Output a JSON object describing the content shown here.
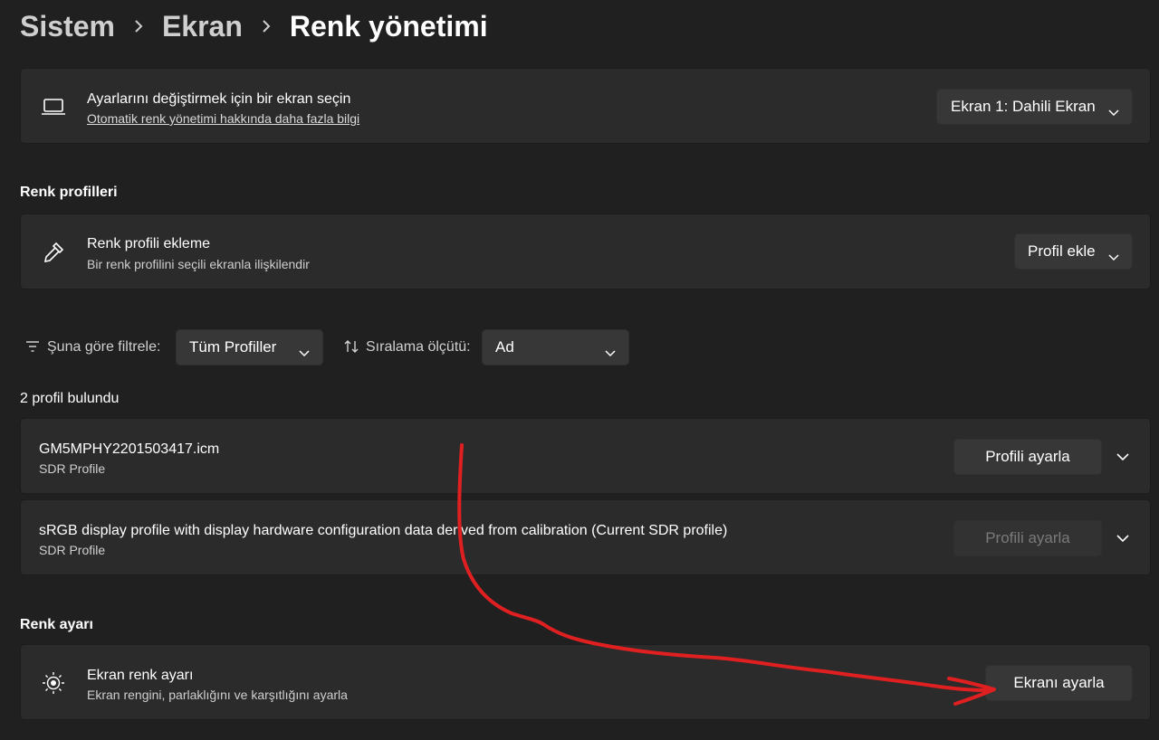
{
  "breadcrumb": {
    "items": [
      "Sistem",
      "Ekran",
      "Renk yönetimi"
    ]
  },
  "display_select": {
    "title": "Ayarlarını değiştirmek için bir ekran seçin",
    "link": "Otomatik renk yönetimi hakkında daha fazla bilgi",
    "dropdown_value": "Ekran 1: Dahili Ekran"
  },
  "color_profiles": {
    "section_title": "Renk profilleri",
    "add_title": "Renk profili ekleme",
    "add_subtitle": "Bir renk profilini seçili ekranla ilişkilendir",
    "add_button": "Profil ekle"
  },
  "filters": {
    "filter_label": "Şuna göre filtrele:",
    "filter_value": "Tüm Profiller",
    "sort_label": "Sıralama ölçütü:",
    "sort_value": "Ad"
  },
  "results": {
    "count_text": "2 profil bulundu",
    "profiles": [
      {
        "name": "GM5MPHY2201503417.icm",
        "type": "SDR Profile",
        "button": "Profili ayarla",
        "enabled": true
      },
      {
        "name": "sRGB display profile with display hardware configuration data derived from calibration (Current SDR profile)",
        "type": "SDR Profile",
        "button": "Profili ayarla",
        "enabled": false
      }
    ]
  },
  "calibration": {
    "section_title": "Renk ayarı",
    "title": "Ekran renk ayarı",
    "subtitle": "Ekran rengini, parlaklığını ve karşıtlığını ayarla",
    "button": "Ekranı ayarla"
  },
  "colors": {
    "background": "#202020",
    "card": "#2b2b2b",
    "button": "#373737",
    "annotation": "#e02020"
  },
  "icons": [
    "chevron-right-icon",
    "laptop-icon",
    "chevron-down-icon",
    "eyedropper-icon",
    "filter-icon",
    "sort-icon",
    "brightness-icon"
  ]
}
